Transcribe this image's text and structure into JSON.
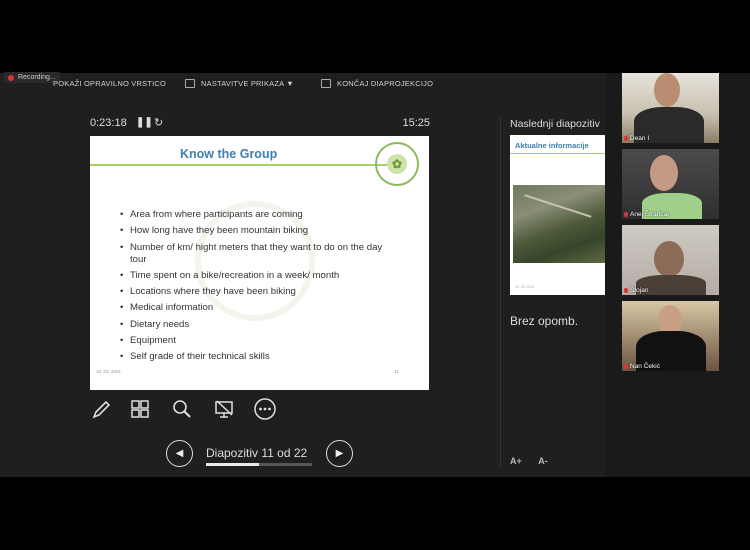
{
  "toolbar": {
    "recording_label": "Recording...",
    "show_taskbar": "POKAŽI OPRAVILNO VRSTICO",
    "display_settings": "NASTAVITVE PRIKAZA ▼",
    "end_show": "KONČAJ DIAPROJEKCIJO"
  },
  "presenter": {
    "elapsed": "0:23:18",
    "pause_icon": "pause-icon",
    "reset_icon": "reset-icon",
    "clock": "15:25"
  },
  "slide": {
    "title": "Know the Group",
    "bullets": [
      "Area from where participants are coming",
      "How long have they been mountain biking",
      "Number of km/ hight meters that they want to do on the day tour",
      "Time spent on a bike/recreation in a week/ month",
      "Locations where they have been biking",
      "Medical information",
      "Dietary needs",
      "Equipment",
      "Self grade of their technical skills"
    ],
    "date": "18. 03. 2021",
    "number": "11"
  },
  "tools": {
    "pen_icon": "pen-icon",
    "slides_grid_icon": "slides-grid-icon",
    "zoom_icon": "zoom-icon",
    "screen_icon": "screen-off-icon",
    "more_icon": "more-options-icon"
  },
  "navigation": {
    "counter": "Diapozitiv 11 od 22",
    "current": 11,
    "total": 22,
    "progress_fraction": 0.5
  },
  "next_slide": {
    "label": "Naslednji diapozitiv",
    "title": "Aktualne informacije",
    "date": "18. 03. 2021"
  },
  "notes": {
    "text": "Brez opomb."
  },
  "font_controls": {
    "increase": "A+",
    "decrease": "A-"
  },
  "participants": [
    {
      "name": "Dean I"
    },
    {
      "name": "Anej Štrancar"
    },
    {
      "name": "Stojan"
    },
    {
      "name": "Nan Čekić"
    }
  ],
  "colors": {
    "slide_title": "#3e7fb0",
    "slide_accent": "#a9cf6a",
    "recording": "#dd3333",
    "background": "#1f1f1f"
  }
}
